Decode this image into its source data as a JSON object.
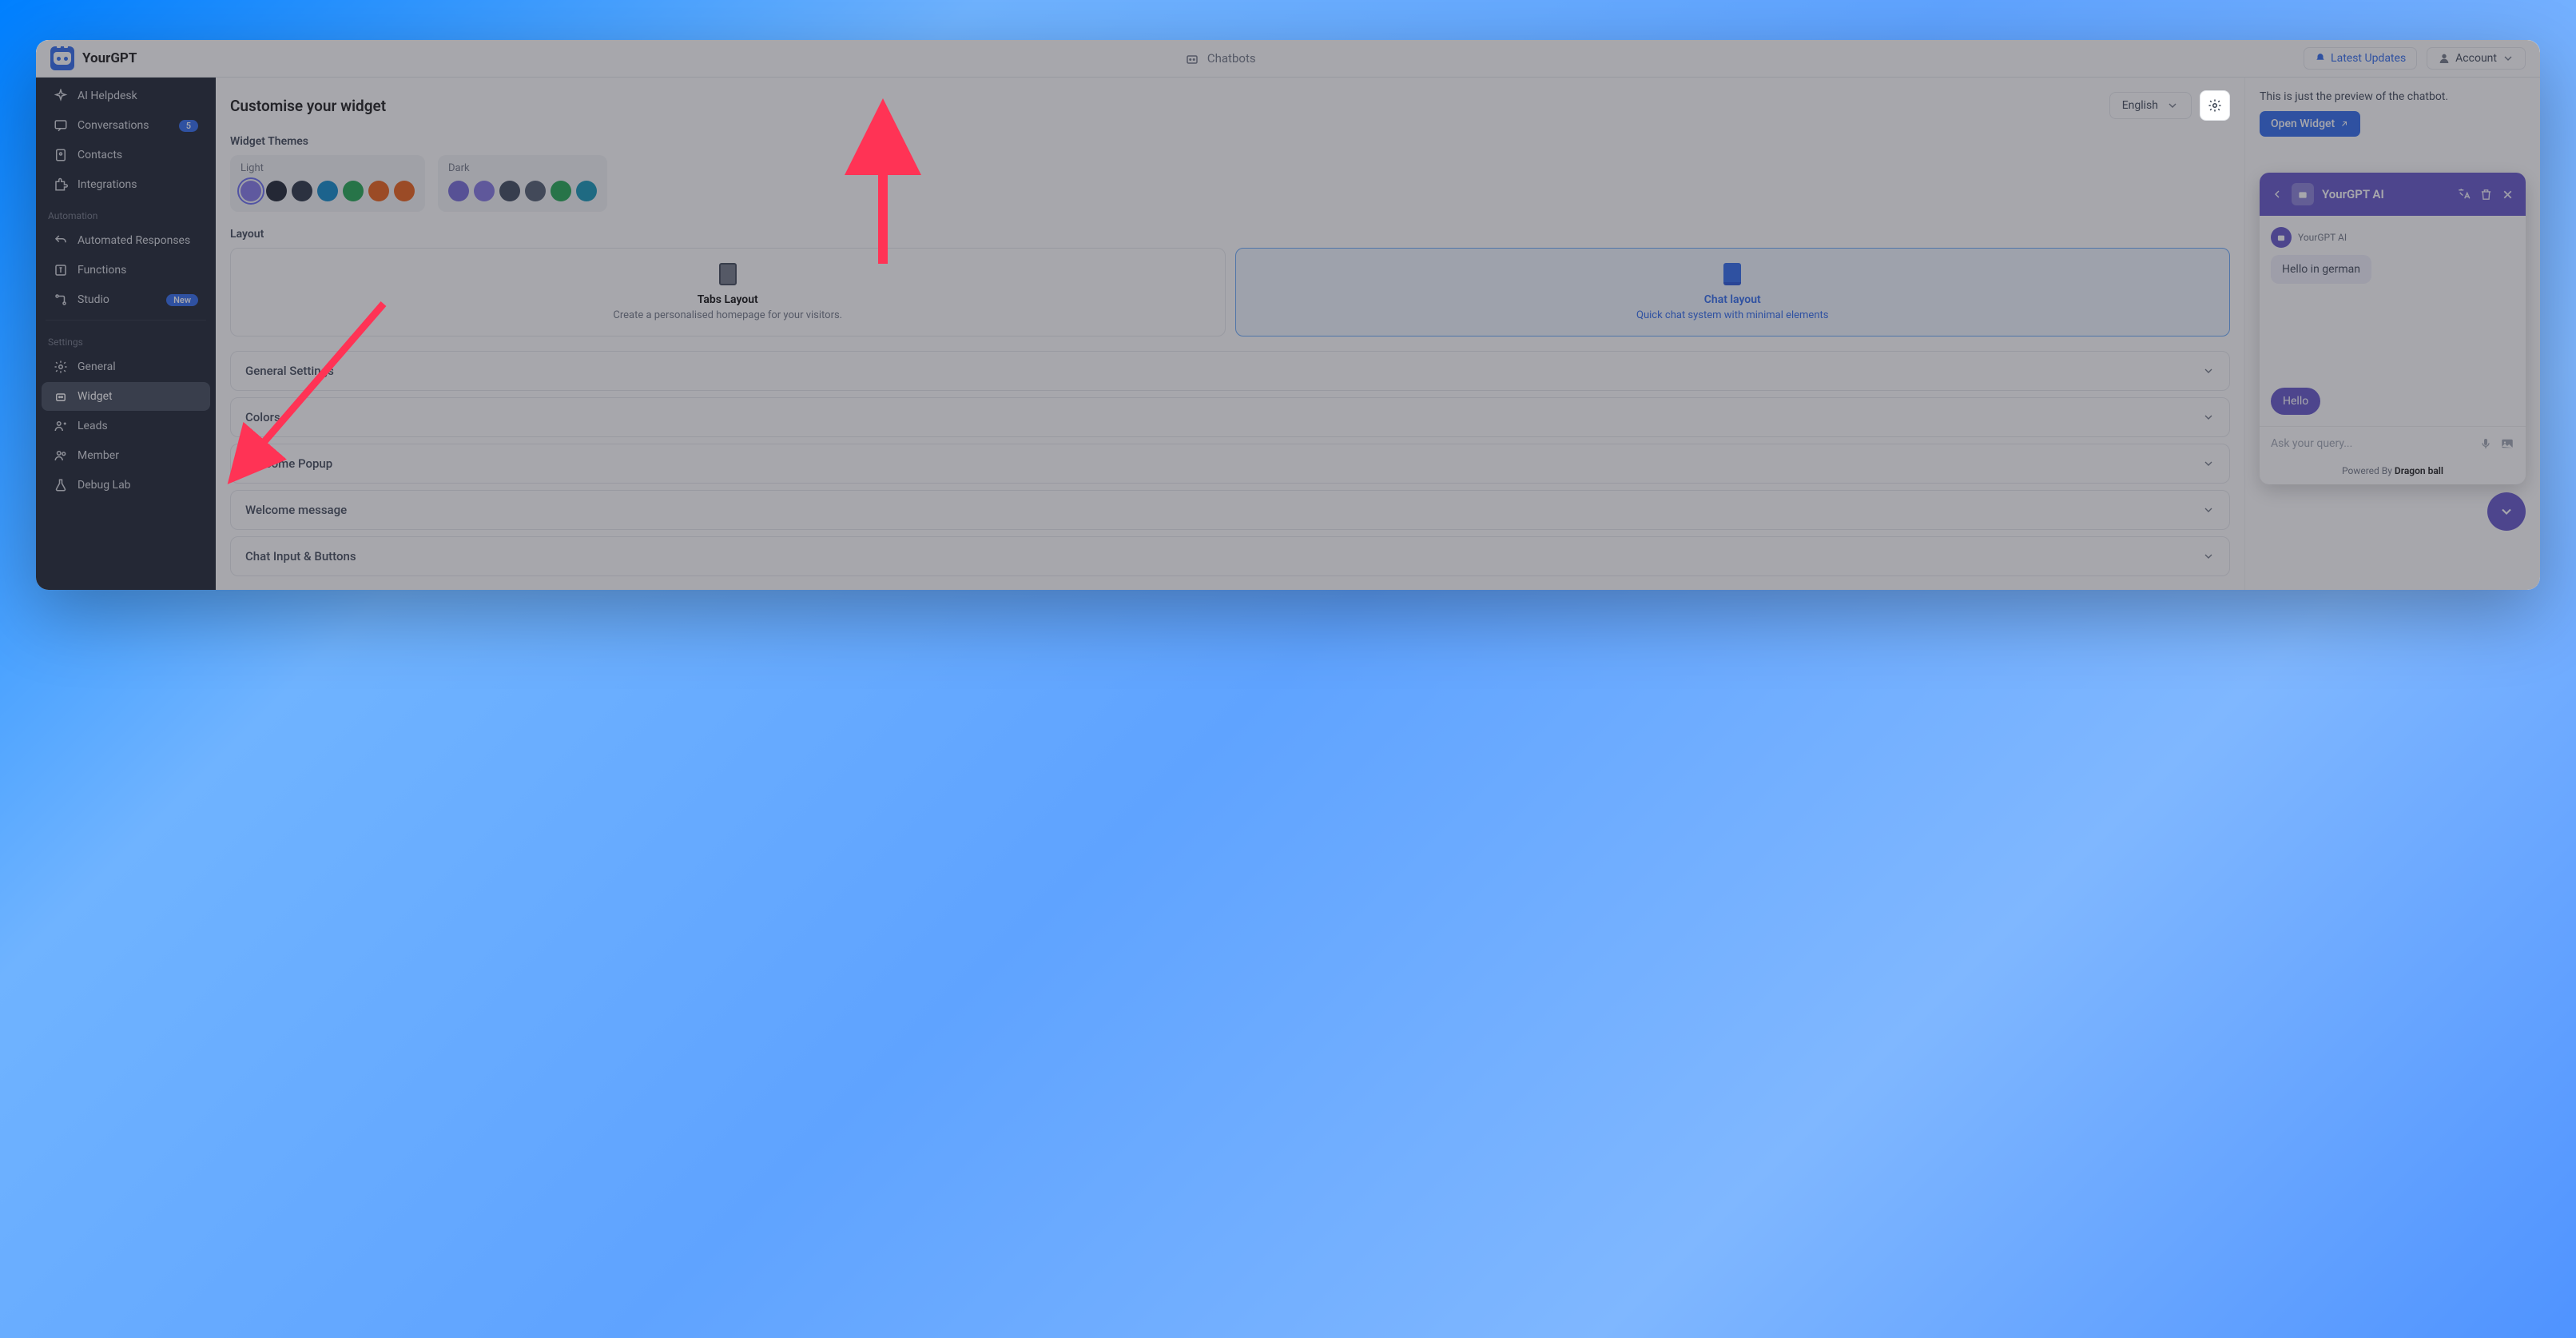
{
  "brand": "YourGPT",
  "breadcrumb": "Chatbots",
  "header": {
    "updates": "Latest Updates",
    "account": "Account"
  },
  "sidebar": {
    "items": [
      {
        "icon": "helpdesk",
        "label": "AI Helpdesk"
      },
      {
        "icon": "chat",
        "label": "Conversations",
        "badge": "5"
      },
      {
        "icon": "contacts",
        "label": "Contacts"
      },
      {
        "icon": "puzzle",
        "label": "Integrations"
      }
    ],
    "automation_header": "Automation",
    "automation": [
      {
        "icon": "reply",
        "label": "Automated Responses"
      },
      {
        "icon": "fn",
        "label": "Functions"
      },
      {
        "icon": "studio",
        "label": "Studio",
        "badge": "New"
      }
    ],
    "settings_header": "Settings",
    "settings": [
      {
        "icon": "gear",
        "label": "General"
      },
      {
        "icon": "robot",
        "label": "Widget",
        "active": true
      },
      {
        "icon": "leads",
        "label": "Leads"
      },
      {
        "icon": "member",
        "label": "Member"
      },
      {
        "icon": "flask",
        "label": "Debug Lab"
      }
    ]
  },
  "page": {
    "title": "Customise your widget",
    "language": "English",
    "themes_label": "Widget Themes",
    "light": "Light",
    "dark": "Dark",
    "light_colors": [
      "#7c71e8",
      "#111827",
      "#1e293b",
      "#0284c7",
      "#16a34a",
      "#ea580c",
      "#ea580c"
    ],
    "dark_colors": [
      "#6d63d6",
      "#7c6fe0",
      "#334155",
      "#475569",
      "#16a34a",
      "#0891b2"
    ],
    "layout_label": "Layout",
    "tabs": {
      "title": "Tabs Layout",
      "desc": "Create a personalised homepage for your visitors."
    },
    "chat": {
      "title": "Chat layout",
      "desc": "Quick chat system with minimal elements"
    },
    "accordions": [
      "General Settings",
      "Colors",
      "Welcome Popup",
      "Welcome message",
      "Chat Input & Buttons"
    ]
  },
  "preview": {
    "note": "This is just the preview of the chatbot.",
    "open": "Open Widget",
    "chat_title": "YourGPT AI",
    "bot_name": "YourGPT AI",
    "msg_in": "Hello in german",
    "msg_out": "Hello",
    "placeholder": "Ask your query...",
    "powered": "Powered By ",
    "powered_by": "Dragon ball"
  }
}
